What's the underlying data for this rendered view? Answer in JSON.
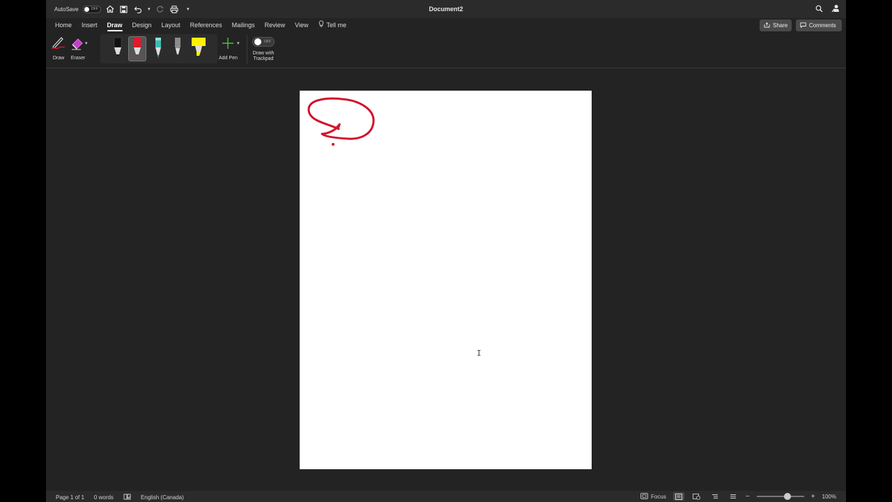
{
  "titlebar": {
    "autosave_label": "AutoSave",
    "autosave_state": "OFF",
    "document_title": "Document2"
  },
  "tabs": [
    {
      "label": "Home"
    },
    {
      "label": "Insert"
    },
    {
      "label": "Draw",
      "active": true
    },
    {
      "label": "Design"
    },
    {
      "label": "Layout"
    },
    {
      "label": "References"
    },
    {
      "label": "Mailings"
    },
    {
      "label": "Review"
    },
    {
      "label": "View"
    },
    {
      "label": "Tell me"
    }
  ],
  "actions": {
    "share_label": "Share",
    "comments_label": "Comments"
  },
  "ribbon": {
    "draw_label": "Draw",
    "eraser_label": "Eraser",
    "add_pen_label": "Add Pen",
    "draw_trackpad_line1": "Draw with",
    "draw_trackpad_line2": "Trackpad",
    "draw_trackpad_state": "OFF",
    "pens": [
      {
        "name": "black-pen",
        "color": "#111111"
      },
      {
        "name": "red-pen",
        "color": "#e0192b",
        "selected": true
      },
      {
        "name": "teal-pencil",
        "color": "#3fb9b0"
      },
      {
        "name": "gray-pencil",
        "color": "#8a8a8a"
      },
      {
        "name": "yellow-highlighter",
        "color": "#fff200"
      }
    ],
    "ink_color": "#d0122b"
  },
  "status": {
    "page": "Page 1 of 1",
    "words": "0 words",
    "language": "English (Canada)",
    "focus_label": "Focus",
    "zoom": "100%"
  }
}
